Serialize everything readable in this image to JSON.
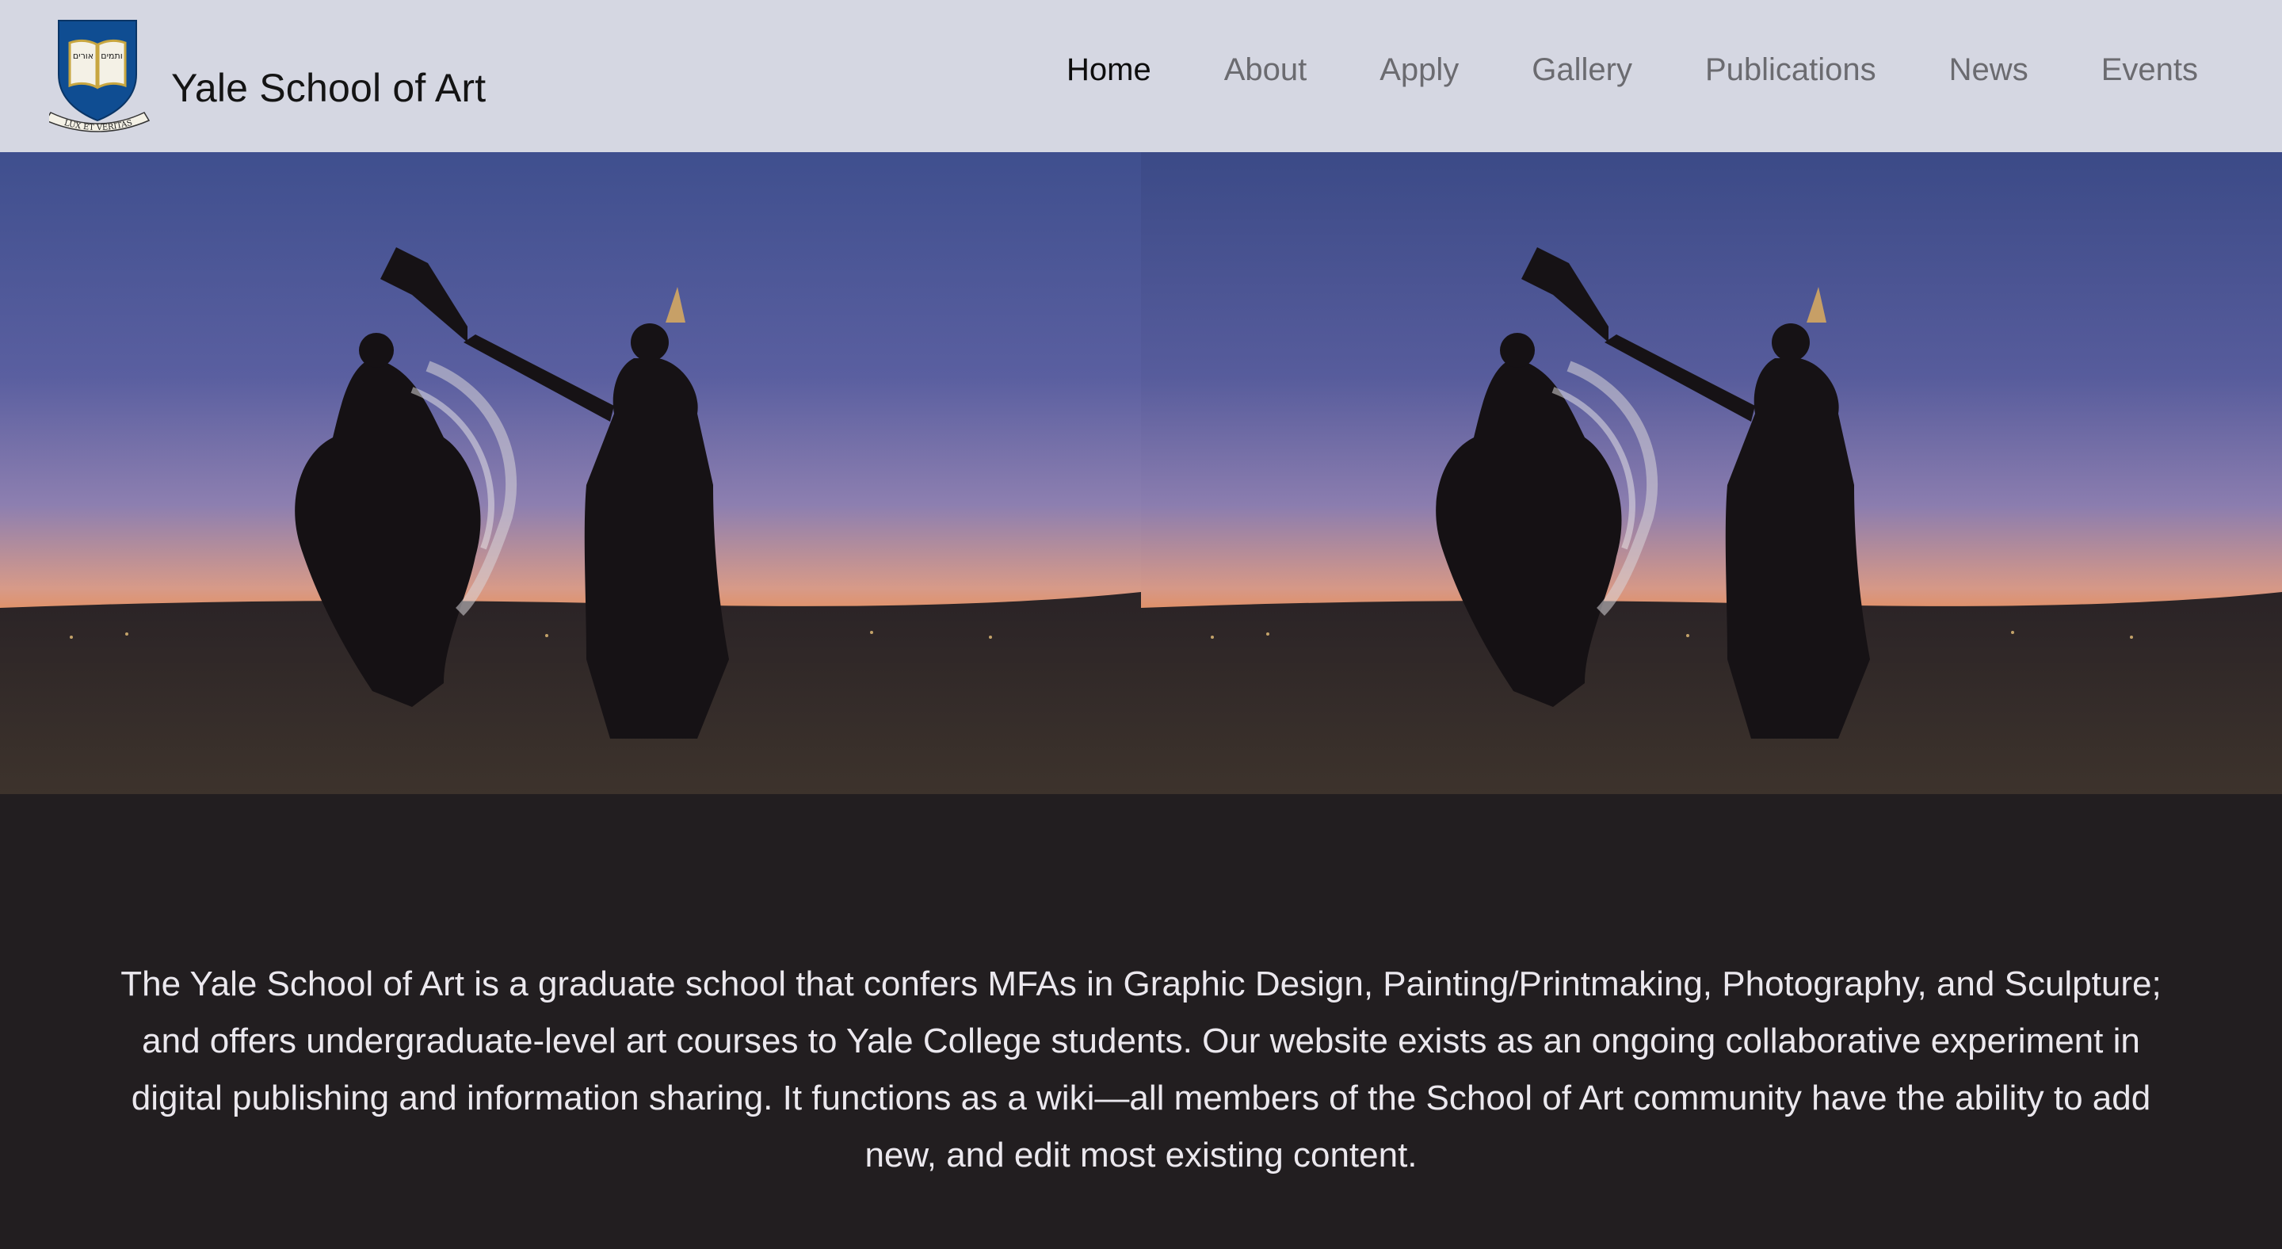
{
  "site": {
    "title": "Yale School of Art",
    "logo": {
      "icon": "yale-crest-icon",
      "book_text_left": "אורים",
      "book_text_right": "ותמים",
      "motto": "LUX ET VERITAS"
    }
  },
  "nav": {
    "items": [
      {
        "label": "Home",
        "active": true
      },
      {
        "label": "About",
        "active": false
      },
      {
        "label": "Apply",
        "active": false
      },
      {
        "label": "Gallery",
        "active": false
      },
      {
        "label": "Publications",
        "active": false
      },
      {
        "label": "News",
        "active": false
      },
      {
        "label": "Events",
        "active": false
      }
    ]
  },
  "hero": {
    "panels": 2,
    "image": "dancers-silhouette-at-dusk"
  },
  "intro": {
    "text": "The Yale School of Art is a graduate school that confers MFAs in Graphic Design, Painting/Printmaking, Photography, and Sculpture; and offers undergraduate-level art courses to Yale College students. Our website exists as an ongoing collaborative experiment in digital publishing and information sharing. It functions as a wiki—all members of the School of Art community have the ability to add new, and edit most existing content."
  },
  "colors": {
    "header_bg": "#d5d7e2",
    "page_bg": "#221e20",
    "nav_active": "#0d0d0d",
    "nav_inactive": "#6b6b70",
    "crest_blue": "#0f4d92",
    "intro_text": "#ebe8ee"
  }
}
